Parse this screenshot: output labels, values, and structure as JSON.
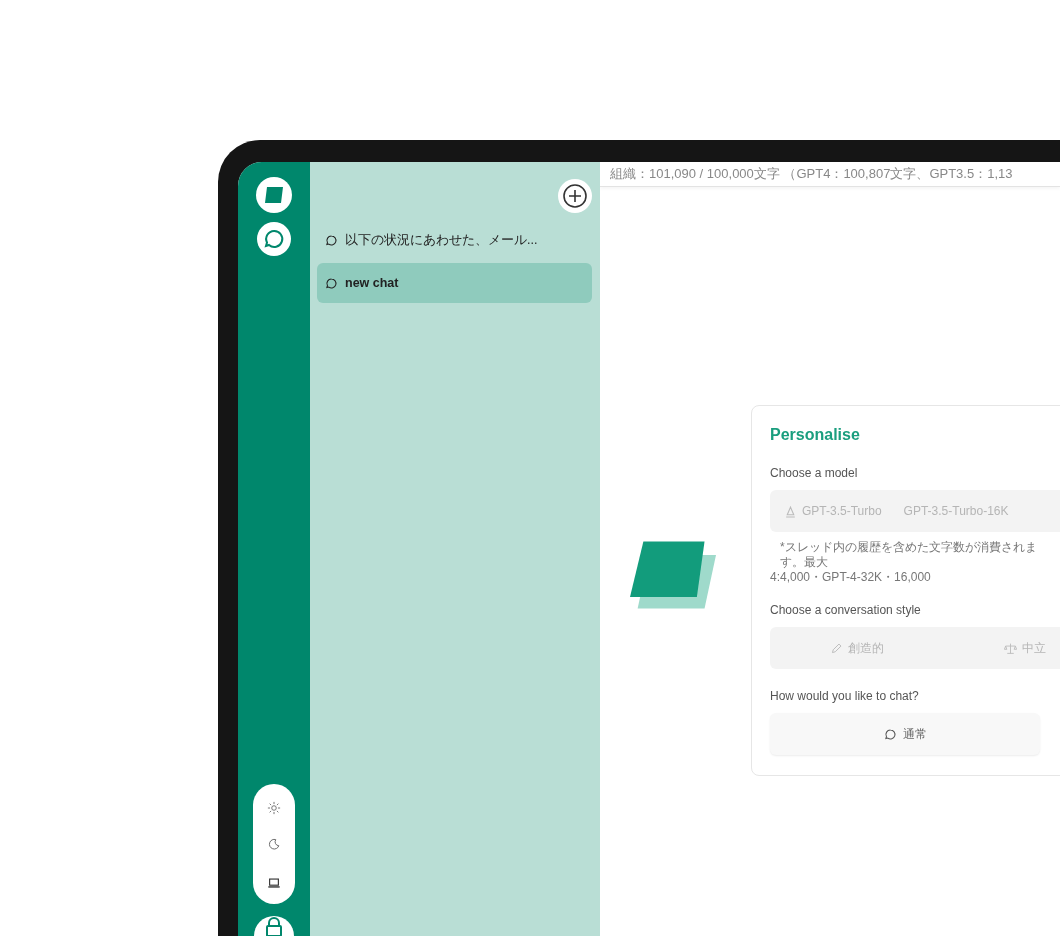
{
  "top_bar": {
    "usage": "組織：101,090 / 100,000文字 （GPT4：100,807文字、GPT3.5：1,13"
  },
  "sidebar": {
    "chats": [
      {
        "title": "以下の状況にあわせた、メール...",
        "selected": false
      },
      {
        "title": "new chat",
        "selected": true
      }
    ]
  },
  "theme_switch": [
    {
      "kind": "light",
      "selected": false
    },
    {
      "kind": "dark",
      "selected": false
    },
    {
      "kind": "system",
      "selected": true
    }
  ],
  "personalise": {
    "title": "Personalise",
    "model_label": "Choose a model",
    "models": [
      {
        "label": "GPT-3.5-Turbo",
        "kind": "flagged"
      },
      {
        "label": "GPT-3.5-Turbo-16K",
        "kind": "plain"
      }
    ],
    "model_note": [
      "*スレッド内の履歴を含めた文字数が消費されます。最大",
      "4:4,000・GPT-4-32K・16,000"
    ],
    "style_label": "Choose a conversation style",
    "styles": [
      {
        "label": "創造的",
        "kind": "creative"
      },
      {
        "label": "中立",
        "kind": "balanced"
      }
    ],
    "chat_label": "How would you like to chat?",
    "chat_modes": [
      {
        "label": "通常",
        "kind": "normal"
      }
    ]
  }
}
